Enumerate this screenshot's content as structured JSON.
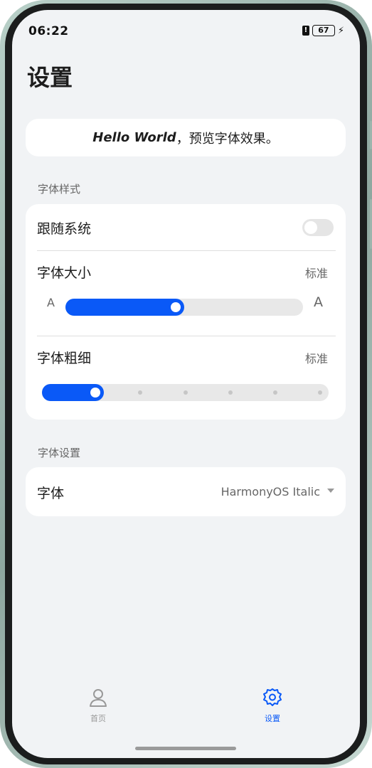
{
  "status_bar": {
    "time": "06:22",
    "battery_level": "67",
    "icons": [
      "sim-alert-icon",
      "battery-icon",
      "charging-icon"
    ]
  },
  "page": {
    "title": "设置"
  },
  "preview": {
    "hello": "Hello World",
    "rest": "，预览字体效果。"
  },
  "font_style": {
    "section_title": "字体样式",
    "follow_system": {
      "label": "跟随系统",
      "enabled": false
    },
    "font_size": {
      "label": "字体大小",
      "value": "标准",
      "small_marker": "A",
      "large_marker": "A",
      "level_fraction": 0.5
    },
    "font_weight": {
      "label": "字体粗细",
      "value": "标准",
      "step": 1,
      "total_steps": 7
    }
  },
  "font_settings": {
    "section_title": "字体设置",
    "font": {
      "label": "字体",
      "value": "HarmonyOS Italic"
    }
  },
  "tab_bar": {
    "tabs": [
      {
        "label": "首页",
        "icon": "person-icon",
        "active": false
      },
      {
        "label": "设置",
        "icon": "gear-icon",
        "active": true
      }
    ]
  },
  "colors": {
    "accent": "#0a59f7",
    "background": "#f1f3f5",
    "card": "#ffffff",
    "inactive_tab": "#999999"
  }
}
